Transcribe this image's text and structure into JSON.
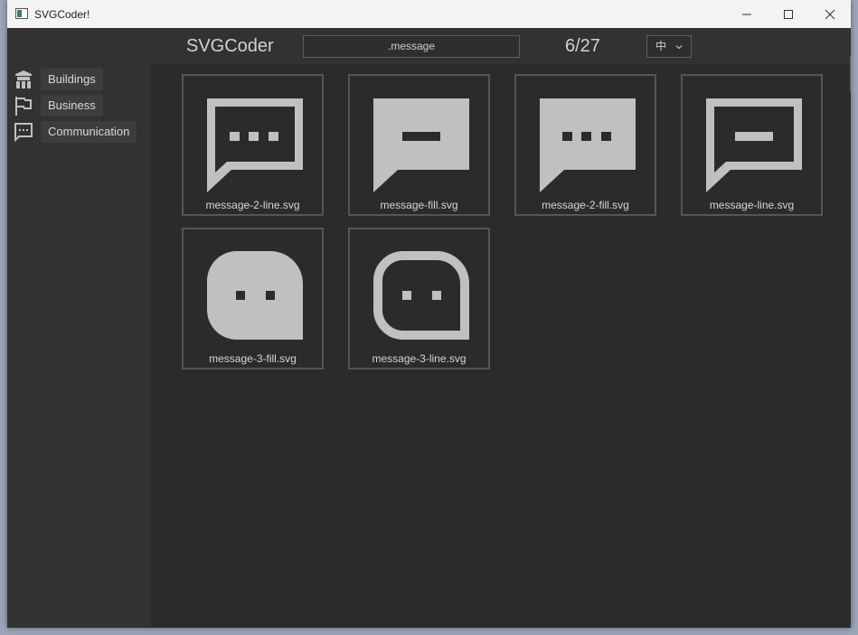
{
  "window": {
    "title": "SVGCoder!"
  },
  "toolbar": {
    "app_name": "SVGCoder",
    "search_value": ".message",
    "counter": "6/27",
    "language": "中"
  },
  "sidebar": {
    "items": [
      {
        "label": "Buildings",
        "icon": "building-icon"
      },
      {
        "label": "Business",
        "icon": "flag-icon"
      },
      {
        "label": "Communication",
        "icon": "message-icon"
      }
    ]
  },
  "icons": [
    {
      "label": "message-2-line.svg",
      "icon": "message-2-line"
    },
    {
      "label": "message-fill.svg",
      "icon": "message-fill"
    },
    {
      "label": "message-2-fill.svg",
      "icon": "message-2-fill"
    },
    {
      "label": "message-line.svg",
      "icon": "message-line"
    },
    {
      "label": "message-3-fill.svg",
      "icon": "message-3-fill"
    },
    {
      "label": "message-3-line.svg",
      "icon": "message-3-line"
    }
  ],
  "colors": {
    "background": "#2b2b2b",
    "panel": "#323232",
    "icon": "#c0c0c0",
    "border": "#555555"
  }
}
